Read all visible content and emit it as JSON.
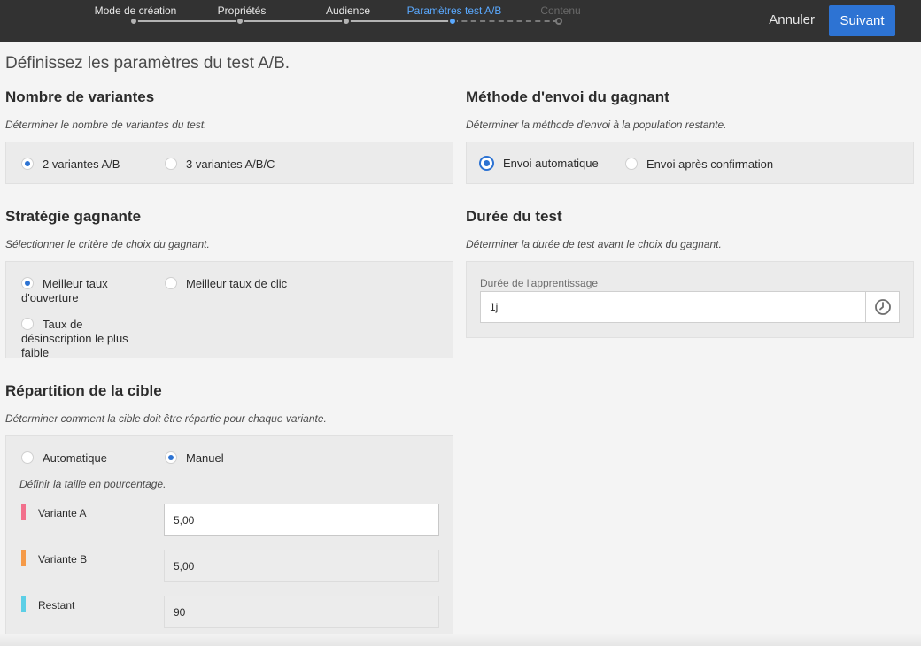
{
  "header": {
    "steps": [
      {
        "label": "Mode de création",
        "state": "done"
      },
      {
        "label": "Propriétés",
        "state": "done"
      },
      {
        "label": "Audience",
        "state": "done"
      },
      {
        "label": "Paramètres test A/B",
        "state": "active"
      },
      {
        "label": "Contenu",
        "state": "disabled"
      }
    ],
    "cancel_label": "Annuler",
    "next_label": "Suivant"
  },
  "page_title": "Définissez les paramètres du test A/B.",
  "variants": {
    "title": "Nombre de variantes",
    "description": "Déterminer le nombre de variantes du test.",
    "options": [
      {
        "label": "2 variantes A/B",
        "selected": true
      },
      {
        "label": "3 variantes A/B/C",
        "selected": false
      }
    ]
  },
  "winner_method": {
    "title": "Méthode d'envoi du gagnant",
    "description": "Déterminer la méthode d'envoi à la population restante.",
    "options": [
      {
        "label": "Envoi automatique",
        "selected": true
      },
      {
        "label": "Envoi après confirmation",
        "selected": false
      }
    ]
  },
  "strategy": {
    "title": "Stratégie gagnante",
    "description": "Sélectionner le critère de choix du gagnant.",
    "options": [
      {
        "label": "Meilleur taux d'ouverture",
        "selected": true
      },
      {
        "label": "Meilleur taux de clic",
        "selected": false
      },
      {
        "label": "Taux de désinscription le plus faible",
        "selected": false
      }
    ]
  },
  "duration": {
    "title": "Durée du test",
    "description": "Déterminer la durée de test avant le choix du gagnant.",
    "field_label": "Durée de l'apprentissage",
    "value": "1j",
    "icon": "clock-icon"
  },
  "split": {
    "title": "Répartition de la cible",
    "description": "Déterminer comment la cible doit être répartie pour chaque variante.",
    "options": [
      {
        "label": "Automatique",
        "selected": false
      },
      {
        "label": "Manuel",
        "selected": true
      }
    ],
    "hint": "Définir la taille en pourcentage.",
    "rows": [
      {
        "label": "Variante A",
        "value": "5,00",
        "color": "#f2708c"
      },
      {
        "label": "Variante B",
        "value": "5,00",
        "color": "#f59a48"
      },
      {
        "label": "Restant",
        "value": "90",
        "color": "#5ccfe6"
      }
    ]
  },
  "colors": {
    "accent": "#2d73d3",
    "active_step": "#5aa9ff",
    "topbar": "#323232"
  }
}
